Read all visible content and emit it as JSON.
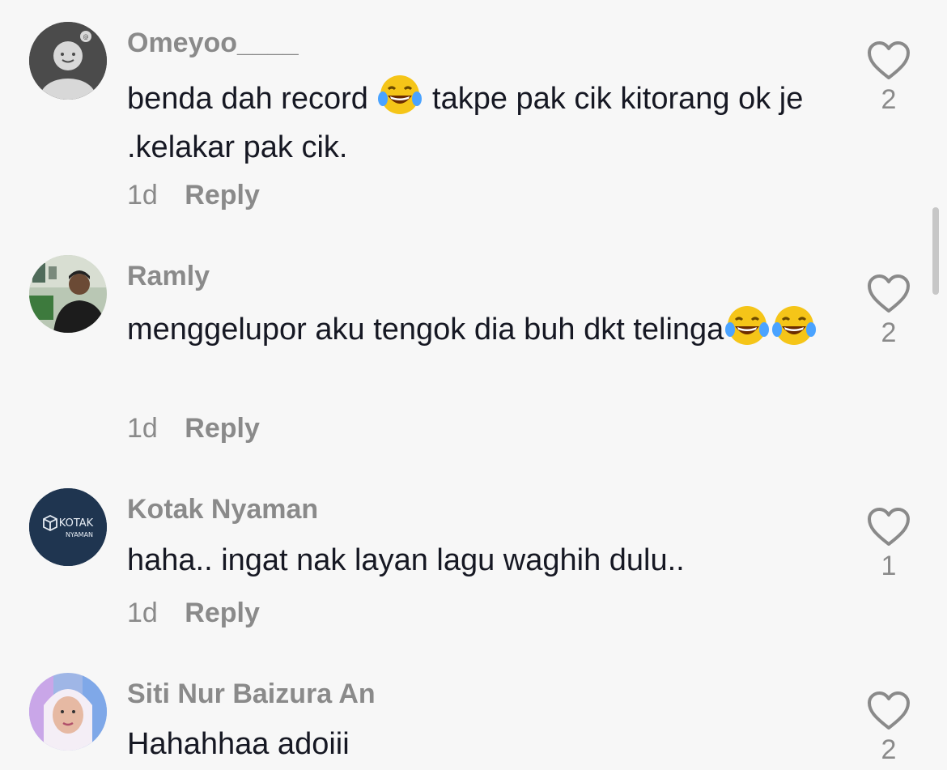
{
  "comments": [
    {
      "username": "Omeyoo____",
      "text_parts": [
        "benda dah record ",
        " takpe pak cik kitorang ok je .kelakar pak cik."
      ],
      "time": "1d",
      "reply_label": "Reply",
      "likes": "2",
      "avatar_icon": "default-avatar-icon"
    },
    {
      "username": "Ramly",
      "text_parts": [
        "menggelupor aku tengok dia buh dkt telinga"
      ],
      "time": "1d",
      "reply_label": "Reply",
      "likes": "2",
      "avatar_icon": "user-photo"
    },
    {
      "username": "Kotak Nyaman",
      "text_parts": [
        "haha.. ingat nak layan lagu waghih dulu.."
      ],
      "time": "1d",
      "reply_label": "Reply",
      "likes": "1",
      "avatar_icon": "kotak-nyaman-logo",
      "avatar_logo_line1": "KOTAK",
      "avatar_logo_line2": "NYAMAN"
    },
    {
      "username": "Siti Nur Baizura An",
      "text_parts": [
        "Hahahhaa adoiii"
      ],
      "likes": "2",
      "avatar_icon": "user-photo"
    }
  ],
  "colors": {
    "background": "#f7f7f7",
    "username": "#8a8a8a",
    "text": "#161823",
    "meta": "#8a8a8a",
    "kotak_avatar_bg": "#1f3550"
  }
}
